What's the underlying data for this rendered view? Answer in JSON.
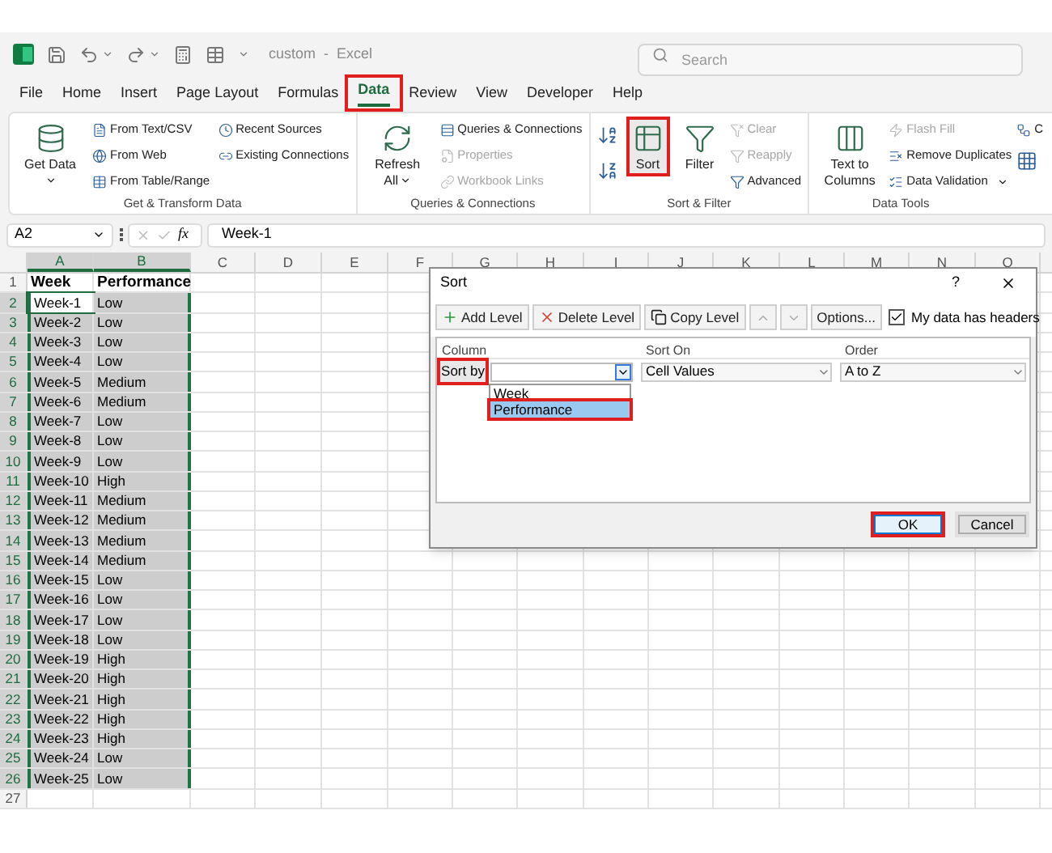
{
  "window": {
    "title": "custom  -  Excel"
  },
  "search": {
    "placeholder": "Search"
  },
  "tabs": [
    {
      "label": "File",
      "selected": false,
      "highlighted": false
    },
    {
      "label": "Home",
      "selected": false,
      "highlighted": false
    },
    {
      "label": "Insert",
      "selected": false,
      "highlighted": false
    },
    {
      "label": "Page Layout",
      "selected": false,
      "highlighted": false
    },
    {
      "label": "Formulas",
      "selected": false,
      "highlighted": false
    },
    {
      "label": "Data",
      "selected": true,
      "highlighted": true
    },
    {
      "label": "Review",
      "selected": false,
      "highlighted": false
    },
    {
      "label": "View",
      "selected": false,
      "highlighted": false
    },
    {
      "label": "Developer",
      "selected": false,
      "highlighted": false
    },
    {
      "label": "Help",
      "selected": false,
      "highlighted": false
    }
  ],
  "ribbon": {
    "groups": [
      {
        "label": "Get & Transform Data",
        "columns": [
          [
            {
              "label": "Get Data",
              "kind": "large",
              "has_menu": true,
              "disabled": false,
              "highlighted": false
            }
          ],
          [
            {
              "label": "From Text/CSV",
              "kind": "small",
              "disabled": false
            },
            {
              "label": "From Web",
              "kind": "small",
              "disabled": false
            },
            {
              "label": "From Table/Range",
              "kind": "small",
              "disabled": false
            }
          ],
          [
            {
              "label": "Recent Sources",
              "kind": "small",
              "disabled": false
            },
            {
              "label": "Existing Connections",
              "kind": "small",
              "disabled": false
            }
          ]
        ]
      },
      {
        "label": "Queries & Connections",
        "columns": [
          [
            {
              "label": "Refresh All",
              "kind": "large",
              "has_menu": true,
              "disabled": false,
              "highlighted": false
            }
          ],
          [
            {
              "label": "Queries & Connections",
              "kind": "small",
              "disabled": false
            },
            {
              "label": "Properties",
              "kind": "small",
              "disabled": true
            },
            {
              "label": "Workbook Links",
              "kind": "small",
              "disabled": true
            }
          ]
        ]
      },
      {
        "label": "Sort & Filter",
        "columns": [
          [
            {
              "kind": "icon"
            },
            {
              "kind": "icon"
            }
          ],
          [
            {
              "label": "Sort",
              "kind": "large",
              "has_menu": false,
              "disabled": false,
              "highlighted": true
            }
          ],
          [
            {
              "label": "Filter",
              "kind": "large",
              "has_menu": false,
              "disabled": false,
              "highlighted": false
            }
          ],
          [
            {
              "label": "Clear",
              "kind": "small",
              "disabled": true
            },
            {
              "label": "Reapply",
              "kind": "small",
              "disabled": true
            },
            {
              "label": "Advanced",
              "kind": "small",
              "disabled": false
            }
          ]
        ]
      },
      {
        "label": "Data Tools",
        "columns": [
          [
            {
              "label": "Text to Columns",
              "kind": "large",
              "has_menu": false,
              "disabled": false,
              "highlighted": false
            }
          ],
          [
            {
              "label": "Flash Fill",
              "kind": "small",
              "disabled": true
            },
            {
              "label": "Remove Duplicates",
              "kind": "small",
              "disabled": false
            },
            {
              "label": "Data Validation",
              "kind": "small",
              "disabled": false,
              "has_menu": true
            }
          ],
          [
            {
              "label": "C",
              "kind": "small"
            },
            {
              "kind": "icon"
            }
          ]
        ]
      }
    ]
  },
  "formula_bar": {
    "name_box": "A2",
    "function_label": "fx",
    "formula": "Week-1"
  },
  "sheet": {
    "columns": [
      "A",
      "B",
      "C",
      "D",
      "E",
      "F",
      "G",
      "H",
      "I",
      "J",
      "K",
      "L",
      "M",
      "N",
      "O"
    ],
    "rows": [
      {
        "number": "1",
        "cells": [
          "Week",
          "Performance"
        ],
        "header": true,
        "selected": false,
        "active": false
      },
      {
        "number": "2",
        "cells": [
          "Week-1",
          "Low"
        ],
        "header": false,
        "selected": true,
        "active": true
      },
      {
        "number": "3",
        "cells": [
          "Week-2",
          "Low"
        ],
        "header": false,
        "selected": true,
        "active": false
      },
      {
        "number": "4",
        "cells": [
          "Week-3",
          "Low"
        ],
        "header": false,
        "selected": true,
        "active": false
      },
      {
        "number": "5",
        "cells": [
          "Week-4",
          "Low"
        ],
        "header": false,
        "selected": true,
        "active": false
      },
      {
        "number": "6",
        "cells": [
          "Week-5",
          "Medium"
        ],
        "header": false,
        "selected": true,
        "active": false
      },
      {
        "number": "7",
        "cells": [
          "Week-6",
          "Medium"
        ],
        "header": false,
        "selected": true,
        "active": false
      },
      {
        "number": "8",
        "cells": [
          "Week-7",
          "Low"
        ],
        "header": false,
        "selected": true,
        "active": false
      },
      {
        "number": "9",
        "cells": [
          "Week-8",
          "Low"
        ],
        "header": false,
        "selected": true,
        "active": false
      },
      {
        "number": "10",
        "cells": [
          "Week-9",
          "Low"
        ],
        "header": false,
        "selected": true,
        "active": false
      },
      {
        "number": "11",
        "cells": [
          "Week-10",
          "High"
        ],
        "header": false,
        "selected": true,
        "active": false
      },
      {
        "number": "12",
        "cells": [
          "Week-11",
          "Medium"
        ],
        "header": false,
        "selected": true,
        "active": false
      },
      {
        "number": "13",
        "cells": [
          "Week-12",
          "Medium"
        ],
        "header": false,
        "selected": true,
        "active": false
      },
      {
        "number": "14",
        "cells": [
          "Week-13",
          "Medium"
        ],
        "header": false,
        "selected": true,
        "active": false
      },
      {
        "number": "15",
        "cells": [
          "Week-14",
          "Medium"
        ],
        "header": false,
        "selected": true,
        "active": false
      },
      {
        "number": "16",
        "cells": [
          "Week-15",
          "Low"
        ],
        "header": false,
        "selected": true,
        "active": false
      },
      {
        "number": "17",
        "cells": [
          "Week-16",
          "Low"
        ],
        "header": false,
        "selected": true,
        "active": false
      },
      {
        "number": "18",
        "cells": [
          "Week-17",
          "Low"
        ],
        "header": false,
        "selected": true,
        "active": false
      },
      {
        "number": "19",
        "cells": [
          "Week-18",
          "Low"
        ],
        "header": false,
        "selected": true,
        "active": false
      },
      {
        "number": "20",
        "cells": [
          "Week-19",
          "High"
        ],
        "header": false,
        "selected": true,
        "active": false
      },
      {
        "number": "21",
        "cells": [
          "Week-20",
          "High"
        ],
        "header": false,
        "selected": true,
        "active": false
      },
      {
        "number": "22",
        "cells": [
          "Week-21",
          "High"
        ],
        "header": false,
        "selected": true,
        "active": false
      },
      {
        "number": "23",
        "cells": [
          "Week-22",
          "High"
        ],
        "header": false,
        "selected": true,
        "active": false
      },
      {
        "number": "24",
        "cells": [
          "Week-23",
          "High"
        ],
        "header": false,
        "selected": true,
        "active": false
      },
      {
        "number": "25",
        "cells": [
          "Week-24",
          "Low"
        ],
        "header": false,
        "selected": true,
        "active": false
      },
      {
        "number": "26",
        "cells": [
          "Week-25",
          "Low"
        ],
        "header": false,
        "selected": true,
        "active": false
      },
      {
        "number": "27",
        "selected": false
      }
    ]
  },
  "sort_dialog": {
    "title": "Sort",
    "help": "?",
    "toolbar": [
      {
        "kind": "add",
        "label": "Add Level",
        "disabled": false
      },
      {
        "kind": "delete",
        "label": "Delete Level",
        "disabled": false
      },
      {
        "kind": "copy",
        "label": "Copy Level",
        "disabled": false
      },
      {
        "kind": "up",
        "disabled": true
      },
      {
        "kind": "down",
        "disabled": true
      },
      {
        "kind": "text",
        "label": "Options...",
        "disabled": false
      }
    ],
    "headers_checkbox": {
      "label": "My data has headers",
      "checked": true
    },
    "columns": [
      "Column",
      "Sort On",
      "Order"
    ],
    "level": {
      "label": "Sort by",
      "highlighted": true,
      "column_expanded": true,
      "sort_on": "Cell Values",
      "order": "A to Z"
    },
    "column_options": [
      {
        "label": "Week",
        "selected": false,
        "highlighted": false
      },
      {
        "label": "Performance",
        "selected": true,
        "highlighted": true
      }
    ],
    "buttons": [
      {
        "label": "OK",
        "kind": "primary",
        "highlighted": true
      },
      {
        "label": "Cancel",
        "kind": "secondary",
        "highlighted": false
      }
    ]
  }
}
